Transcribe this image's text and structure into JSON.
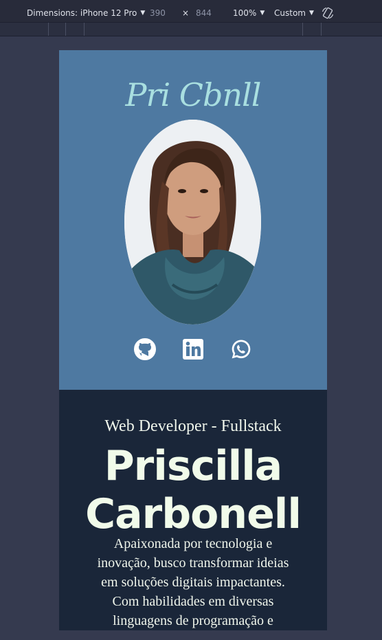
{
  "devtools": {
    "dimensions_label": "Dimensions: iPhone 12 Pro",
    "width": "390",
    "times": "×",
    "height": "844",
    "zoom": "100%",
    "throttle": "Custom",
    "rotate_icon": "rotate-icon",
    "caret_icon": "caret-down-icon"
  },
  "portfolio": {
    "logo": "Pri Cbnll",
    "avatar_icon": "profile-photo",
    "social": [
      {
        "name": "github",
        "icon": "github-icon"
      },
      {
        "name": "linkedin",
        "icon": "linkedin-icon"
      },
      {
        "name": "whatsapp",
        "icon": "whatsapp-icon"
      }
    ],
    "role": "Web Developer - Fullstack",
    "name_first": "Priscilla",
    "name_last": "Carbonell",
    "bio": "Apaixonada por tecnologia e inovação, busco transformar ideias em soluções digitais impactantes. Com habilidades em diversas linguagens de programação e"
  },
  "colors": {
    "hero_bg": "#4e79a1",
    "about_bg": "#1a2639",
    "logo": "#a9dfe0",
    "text": "#f0f6ec"
  }
}
